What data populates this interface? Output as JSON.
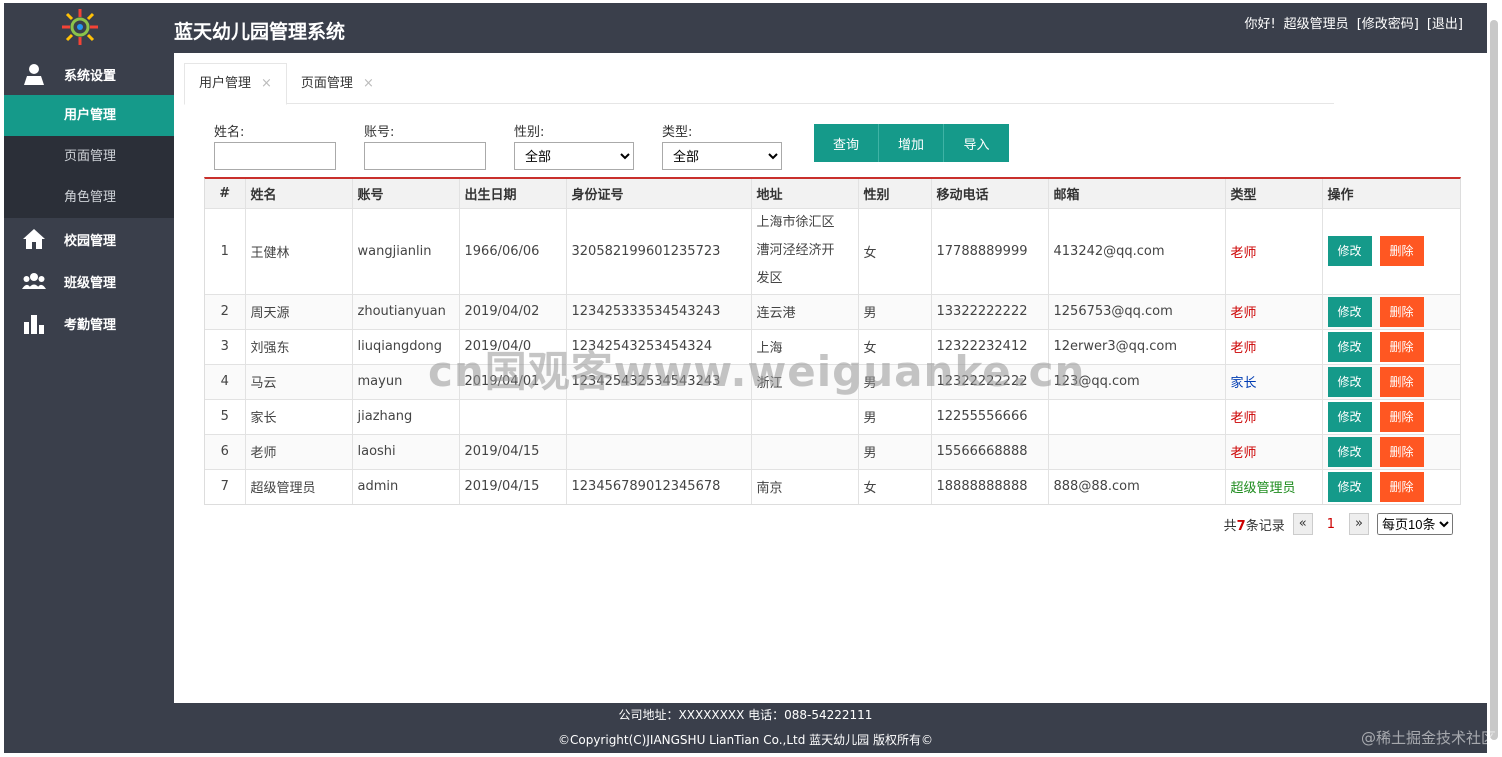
{
  "header": {
    "app_title": "蓝天幼儿园管理系统",
    "greeting": "你好!",
    "username": "超级管理员",
    "change_password": "[修改密码]",
    "logout": "[退出]"
  },
  "sidebar": {
    "groups": [
      {
        "label": "系统设置",
        "icon": "user-icon"
      },
      {
        "label": "校园管理",
        "icon": "home-icon"
      },
      {
        "label": "班级管理",
        "icon": "group-icon"
      },
      {
        "label": "考勤管理",
        "icon": "bar-chart-icon"
      }
    ],
    "sub_items": [
      {
        "label": "用户管理",
        "active": true
      },
      {
        "label": "页面管理"
      },
      {
        "label": "角色管理"
      }
    ]
  },
  "tabs": [
    {
      "label": "用户管理",
      "close": "×"
    },
    {
      "label": "页面管理",
      "close": "×"
    }
  ],
  "filters": {
    "name_label": "姓名:",
    "account_label": "账号:",
    "gender_label": "性别:",
    "gender_value": "全部",
    "type_label": "类型:",
    "type_value": "全部"
  },
  "buttons": {
    "query": "查询",
    "add": "增加",
    "import": "导入"
  },
  "table": {
    "headers": [
      "#",
      "姓名",
      "账号",
      "出生日期",
      "身份证号",
      "地址",
      "性别",
      "移动电话",
      "邮箱",
      "类型",
      "操作"
    ],
    "rows": [
      {
        "idx": "1",
        "name": "王健林",
        "account": "wangjianlin",
        "birth": "1966/06/06",
        "id": "320582199601235723",
        "addr": [
          "上海市徐汇区",
          "漕河泾经济开",
          "发区"
        ],
        "gender": "女",
        "phone": "17788889999",
        "email": "413242@qq.com",
        "type": "老师",
        "type_class": "type-teacher"
      },
      {
        "idx": "2",
        "name": "周天源",
        "account": "zhoutianyuan",
        "birth": "2019/04/02",
        "id": "123425333534543243",
        "addr": [
          "连云港"
        ],
        "gender": "男",
        "phone": "13322222222",
        "email": "1256753@qq.com",
        "type": "老师",
        "type_class": "type-teacher"
      },
      {
        "idx": "3",
        "name": "刘强东",
        "account": "liuqiangdong",
        "birth": "2019/04/0",
        "id": "12342543253454324",
        "addr": [
          "上海"
        ],
        "gender": "女",
        "phone": "12322232412",
        "email": "12erwer3@qq.com",
        "type": "老师",
        "type_class": "type-teacher"
      },
      {
        "idx": "4",
        "name": "马云",
        "account": "mayun",
        "birth": "2019/04/01",
        "id": "123425432534543243",
        "addr": [
          "浙江"
        ],
        "gender": "男",
        "phone": "12322222222",
        "email": "123@qq.com",
        "type": "家长",
        "type_class": "type-parent"
      },
      {
        "idx": "5",
        "name": "家长",
        "account": "jiazhang",
        "birth": "",
        "id": "",
        "addr": [
          ""
        ],
        "gender": "男",
        "phone": "12255556666",
        "email": "",
        "type": "老师",
        "type_class": "type-teacher"
      },
      {
        "idx": "6",
        "name": "老师",
        "account": "laoshi",
        "birth": "2019/04/15",
        "id": "",
        "addr": [
          ""
        ],
        "gender": "男",
        "phone": "15566668888",
        "email": "",
        "type": "老师",
        "type_class": "type-teacher"
      },
      {
        "idx": "7",
        "name": "超级管理员",
        "account": "admin",
        "birth": "2019/04/15",
        "id": "123456789012345678",
        "addr": [
          "南京"
        ],
        "gender": "女",
        "phone": "18888888888",
        "email": "888@88.com",
        "type": "超级管理员",
        "type_class": "type-admin"
      }
    ],
    "edit_label": "修改",
    "delete_label": "删除"
  },
  "pager": {
    "prefix": "共",
    "total": "7",
    "suffix": "条记录",
    "prev": "«",
    "current": "1",
    "next": "»",
    "page_size": "每页10条"
  },
  "footer": {
    "line1": "公司地址：XXXXXXXX 电话：088-54222111",
    "line2": "©Copyright(C)JIANGSHU LianTian Co.,Ltd 蓝天幼儿园 版权所有©"
  },
  "watermarks": {
    "center": "cn国观客www.weiguanke.cn",
    "corner": "@稀土掘金技术社区"
  },
  "colors": {
    "primary": "#159a8a",
    "danger": "#ff5722",
    "dark": "#3a3f4b"
  }
}
